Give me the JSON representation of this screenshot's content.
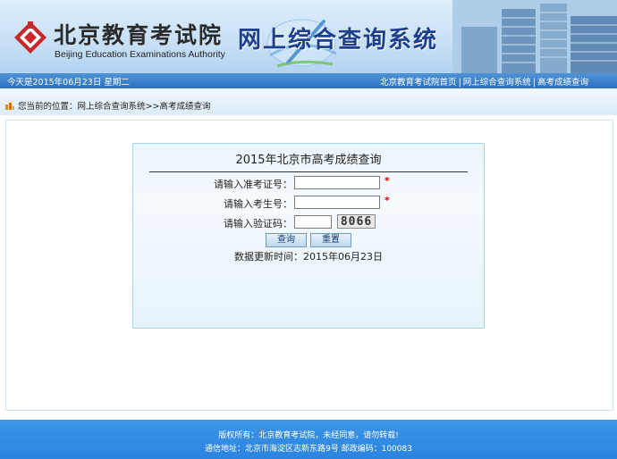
{
  "header": {
    "org_name_cn": "北京教育考试院",
    "org_name_en": "Beijing Education Examinations Authority",
    "system_title": "网上综合查询系统"
  },
  "navbar": {
    "date_text": "今天是2015年06月23日  星期二",
    "links": [
      "北京教育考试院首页",
      "网上综合查询系统",
      "高考成绩查询"
    ],
    "separator": "|"
  },
  "breadcrumb": {
    "prefix": "您当前的位置：",
    "path_1": "网上综合查询系统",
    "arrow": ">>",
    "path_2": "高考成绩查询"
  },
  "form": {
    "title": "2015年北京市高考成绩查询",
    "ticket_label": "请输入准考证号：",
    "ticket_value": "",
    "student_label": "请输入考生号：",
    "student_value": "",
    "captcha_label": "请输入验证码：",
    "captcha_value": "",
    "captcha_image_text": "8066",
    "required_mark": "*",
    "submit_label": "查询",
    "reset_label": "重置",
    "update_label": "数据更新时间：",
    "update_date": "2015年06月23日"
  },
  "footer": {
    "line1": "版权所有：北京教育考试院，未经同意，请勿转载!",
    "line2": "通信地址：北京市海淀区志新东路9号 邮政编码：100083"
  },
  "colors": {
    "nav_blue": "#2c70c0",
    "footer_blue": "#2b84df",
    "title_blue": "#1d3f8c",
    "required_red": "#dd0000",
    "logo_red": "#c8282c"
  }
}
